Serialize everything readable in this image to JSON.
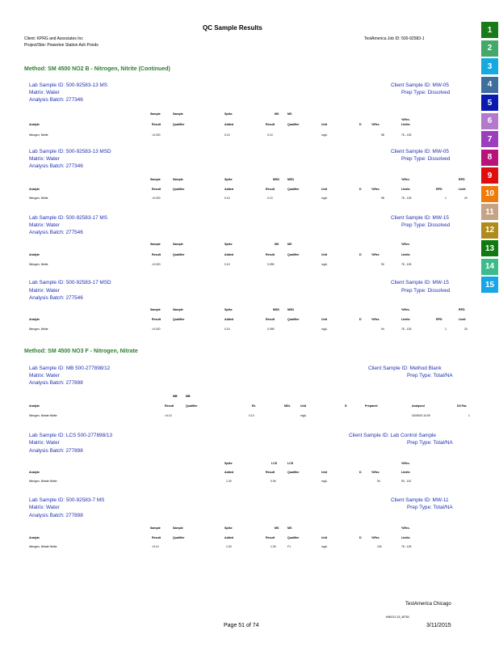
{
  "title": "QC          Sample          Results",
  "client": "Client: KPRG and Associates Inc",
  "project": "Project/Site: Powerton Station Ash Ponds",
  "job": "TestAmerica Job ID: 500-92583-1",
  "tabs": [
    {
      "label": "1",
      "color": "#1a7a1a"
    },
    {
      "label": "2",
      "color": "#43a86a"
    },
    {
      "label": "3",
      "color": "#14a9e0"
    },
    {
      "label": "4",
      "color": "#3e6e9e"
    },
    {
      "label": "5",
      "color": "#0a19b0"
    },
    {
      "label": "6",
      "color": "#b478cc"
    },
    {
      "label": "7",
      "color": "#9b3fbf"
    },
    {
      "label": "8",
      "color": "#b8137a"
    },
    {
      "label": "9",
      "color": "#e00d0d"
    },
    {
      "label": "10",
      "color": "#f07a0a"
    },
    {
      "label": "11",
      "color": "#c4a484"
    },
    {
      "label": "12",
      "color": "#b08a1a"
    },
    {
      "label": "13",
      "color": "#0f7a0f"
    },
    {
      "label": "14",
      "color": "#3cbc8c"
    },
    {
      "label": "15",
      "color": "#18a6e6"
    }
  ],
  "method1": "Method:      SM    4500     NO2    B  - Nitrogen,          Nitrite      (Continued)",
  "method2": "Method:      SM    4500     NO3    F  - Nitrogen,          Nitrate",
  "s1": {
    "lab": "Lab     Sample     ID:    500-92583-13          MS",
    "client": "Client     Sample     ID:    MW-05",
    "matrix": "Matrix:     Water",
    "prep": "Prep    Type:     Dissolved",
    "batch": "Analysis      Batch:     277346"
  },
  "s2": {
    "lab": "Lab     Sample     ID:    500-92583-13          MSD",
    "client": "Client     Sample     ID:    MW-05",
    "matrix": "Matrix:     Water",
    "prep": "Prep    Type:     Dissolved",
    "batch": "Analysis      Batch:     277346"
  },
  "s3": {
    "lab": "Lab     Sample     ID:    500-92583-17          MS",
    "client": "Client     Sample     ID:    MW-15",
    "matrix": "Matrix:     Water",
    "prep": "Prep    Type:     Dissolved",
    "batch": "Analysis      Batch:     277546"
  },
  "s4": {
    "lab": "Lab     Sample     ID:    500-92583-17          MSD",
    "client": "Client     Sample     ID:    MW-15",
    "matrix": "Matrix:     Water",
    "prep": "Prep    Type:     Dissolved",
    "batch": "Analysis      Batch:     277546"
  },
  "s5": {
    "lab": "Lab     Sample     ID:    MB   500-277898/12",
    "client": "Client     Sample     ID:    Method      Blank",
    "matrix": "Matrix:     Water",
    "prep": "Prep    Type:    Total/NA",
    "batch": "Analysis      Batch:     277898"
  },
  "s6": {
    "lab": "Lab     Sample     ID:    LCS    500-277898/13",
    "client": "Client     Sample     ID:    Lab    Control       Sample",
    "matrix": "Matrix:     Water",
    "prep": "Prep    Type:    Total/NA",
    "batch": "Analysis      Batch:     277898"
  },
  "s7": {
    "lab": "Lab     Sample     ID:    500-92583-7          MS",
    "client": "Client     Sample     ID:    MW-11",
    "matrix": "Matrix:     Water",
    "prep": "Prep    Type:    Total/NA",
    "batch": "Analysis      Batch:     277898"
  },
  "col": {
    "sample": "Sample",
    "spike": "Spike",
    "ms": "MS",
    "msd": "MSD",
    "mb": "MB",
    "lcs": "LCS",
    "result": "Result",
    "qualifier": "Qualifier",
    "added": "Added",
    "unit": "Unit",
    "d": "D",
    "rec": "%Rec",
    "recs": "%Rec.",
    "limits": "Limits",
    "rpd": "RPD",
    "limit": "Limit",
    "analyte": "Analyte",
    "rl": "RL",
    "mdl": "MDL",
    "prepared": "Prepared",
    "analyzed": "Analyzed",
    "dilfac": "Dil Fac"
  },
  "rows": {
    "r1": {
      "analyte": "Nitrogen, Nitrite",
      "sr": "<0.020",
      "add": "0.10",
      "res": "0.10",
      "unit": "mg/L",
      "rec": "98",
      "lim": "75 - 125"
    },
    "r2": {
      "analyte": "Nitrogen, Nitrite",
      "sr": "<0.020",
      "add": "0.10",
      "res": "0.10",
      "unit": "mg/L",
      "rec": "98",
      "lim": "75 - 125",
      "rpd": "1",
      "rlim": "20"
    },
    "r3": {
      "analyte": "Nitrogen, Nitrite",
      "sr": "<0.020",
      "add": "0.10",
      "res": "0.090",
      "unit": "mg/L",
      "rec": "90",
      "lim": "75 - 125"
    },
    "r4": {
      "analyte": "Nitrogen, Nitrite",
      "sr": "<0.020",
      "add": "0.10",
      "res": "0.095",
      "unit": "mg/L",
      "rec": "94",
      "lim": "75 - 125",
      "rpd": "1",
      "rlim": "20"
    },
    "r5": {
      "analyte": "Nitrogen, Nitrate Nitrite",
      "res": "<0.10",
      "rl": "0.10",
      "unit": "mg/L",
      "analyzed": "03/09/15 10:09",
      "dil": "1"
    },
    "r6": {
      "analyte": "Nitrogen, Nitrate Nitrite",
      "add": "1.00",
      "res": "0.94",
      "unit": "mg/L",
      "rec": "94",
      "lim": "90 - 110"
    },
    "r7": {
      "analyte": "Nitrogen, Nitrate Nitrite",
      "sr": "<0.10",
      "add": "1.00",
      "res": "1.00",
      "q": "F1",
      "unit": "mg/L",
      "rec": "100",
      "lim": "75 - 125"
    }
  },
  "footer": {
    "lab": "TestAmerica Chicago",
    "doc": "MWG13-15_48784",
    "page": "Page     51     of     74",
    "date": "3/11/2015"
  }
}
